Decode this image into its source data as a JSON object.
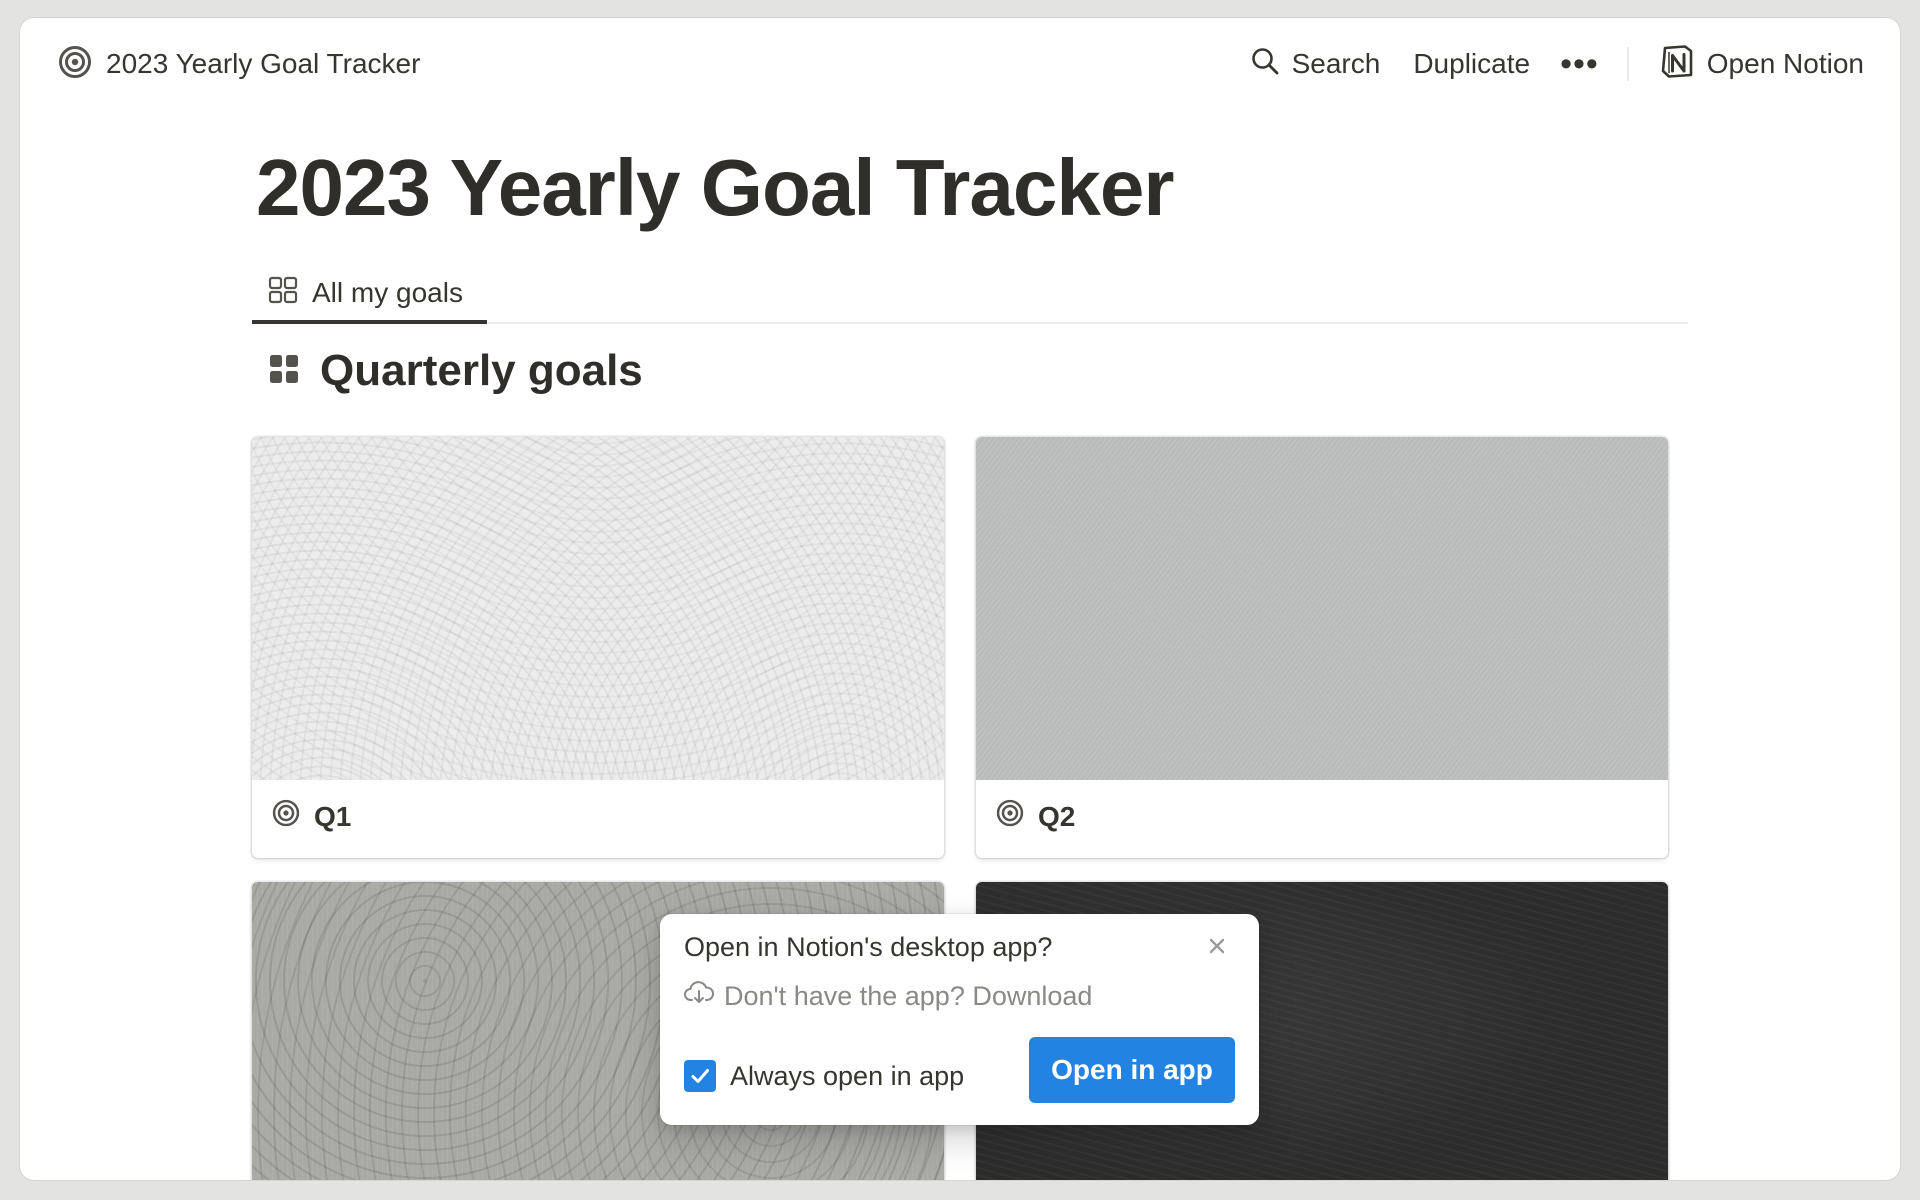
{
  "topbar": {
    "breadcrumb_title": "2023 Yearly Goal Tracker",
    "breadcrumb_icon": "target-icon",
    "search_label": "Search",
    "duplicate_label": "Duplicate",
    "more_label": "•••",
    "open_notion_label": "Open Notion"
  },
  "page": {
    "title": "2023 Yearly Goal Tracker",
    "tabs": [
      {
        "label": "All my goals",
        "icon": "gallery-view-icon",
        "active": true
      }
    ],
    "section_title": "Quarterly goals",
    "section_icon": "gallery-grid-icon"
  },
  "gallery": {
    "cards": [
      {
        "title": "Q1",
        "icon": "target-icon",
        "cover": "white-plaster-texture"
      },
      {
        "title": "Q2",
        "icon": "target-icon",
        "cover": "gray-concrete-texture"
      },
      {
        "title": "",
        "cover": "gray-damask-texture"
      },
      {
        "title": "",
        "cover": "dark-chalkboard-texture"
      }
    ]
  },
  "popup": {
    "title": "Open in Notion's desktop app?",
    "download_text": "Don't have the app? Download",
    "always_open_label": "Always open in app",
    "always_open_checked": true,
    "open_button": "Open in app"
  },
  "colors": {
    "accent": "#2383e2",
    "text": "#37352f",
    "muted": "#8a8985"
  }
}
